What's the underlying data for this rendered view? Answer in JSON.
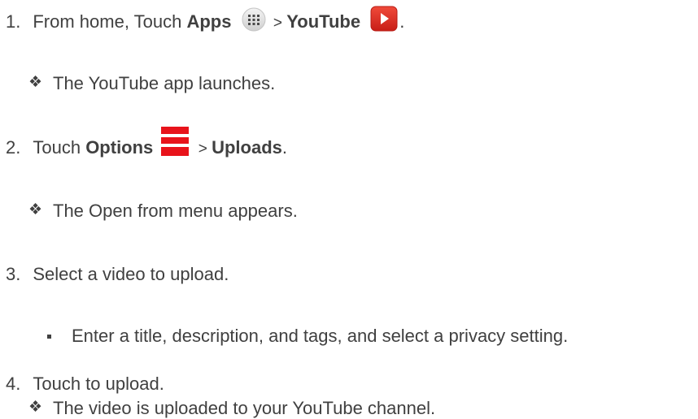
{
  "steps": [
    {
      "number": "1.",
      "prefix": "From home, Touch ",
      "bold1": "Apps",
      "icon1": "apps-grid-icon",
      "sep": " > ",
      "bold2": "YouTube",
      "icon2": "youtube-play-icon",
      "suffix": "."
    },
    {
      "number": "2.",
      "prefix": "Touch ",
      "bold1": "Options",
      "icon1": "menu-options-icon",
      "sep": " > ",
      "bold2": "Uploads",
      "suffix": "."
    },
    {
      "number": "3.",
      "text": "Select a video to upload."
    },
    {
      "number": "4.",
      "text": "Touch to upload."
    }
  ],
  "notes": {
    "step1": "The YouTube app launches.",
    "step2": "The Open from menu appears.",
    "step3": "Enter a title, description, and tags, and select a privacy setting.",
    "step4": "The video is uploaded to your YouTube channel."
  },
  "colors": {
    "text": "#404040",
    "youtube_red": "#e52d27",
    "options_red": "#e8131b"
  }
}
